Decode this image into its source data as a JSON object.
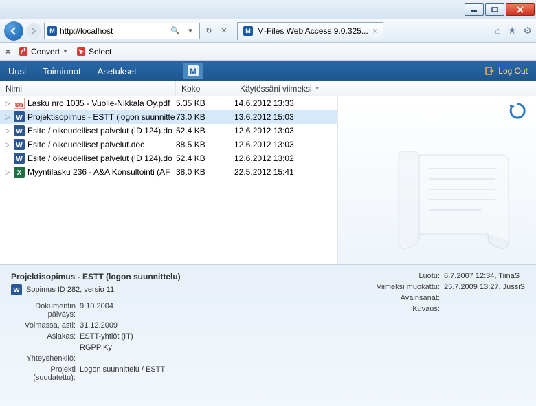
{
  "window": {
    "url": "http://localhost",
    "tab_title": "M-Files Web Access 9.0.325..."
  },
  "toolbar2": {
    "convert": "Convert",
    "select": "Select"
  },
  "menubar": {
    "new": "Uusi",
    "actions": "Toiminnot",
    "settings": "Asetukset",
    "logout": "Log Out"
  },
  "columns": {
    "name": "Nimi",
    "size": "Koko",
    "date": "Käytössäni viimeksi"
  },
  "files": [
    {
      "expandable": true,
      "icon": "pdf",
      "name": "Lasku nro 1035 - Vuolle-Nikkala Oy.pdf",
      "size": "5.35 KB",
      "date": "14.6.2012 13:33",
      "selected": false
    },
    {
      "expandable": true,
      "icon": "word",
      "name": "Projektisopimus - ESTT (logon suunnitte",
      "size": "73.0 KB",
      "date": "13.6.2012 15:03",
      "selected": true
    },
    {
      "expandable": true,
      "icon": "word",
      "name": "Esite / oikeudelliset palvelut (ID 124).do",
      "size": "52.4 KB",
      "date": "12.6.2012 13:03",
      "selected": false
    },
    {
      "expandable": true,
      "icon": "word",
      "name": "Esite / oikeudelliset palvelut.doc",
      "size": "88.5 KB",
      "date": "12.6.2012 13:03",
      "selected": false
    },
    {
      "expandable": false,
      "icon": "word",
      "name": "Esite / oikeudelliset palvelut (ID 124).do",
      "size": "52.4 KB",
      "date": "12.6.2012 13:02",
      "selected": false
    },
    {
      "expandable": true,
      "icon": "excel",
      "name": "Myyntilasku 236 - A&A Konsultointi (AF",
      "size": "38.0 KB",
      "date": "22.5.2012 15:41",
      "selected": false
    }
  ],
  "details": {
    "title": "Projektisopimus - ESTT (logon suunnittelu)",
    "subtitle": "Sopimus ID 282, versio 11",
    "left": [
      {
        "label": "Dokumentin päiväys:",
        "value": "9.10.2004"
      },
      {
        "label": "Voimassa, asti:",
        "value": "31.12.2009"
      },
      {
        "label": "Asiakas:",
        "value": "ESTT-yhtiöt (IT)"
      },
      {
        "label": "",
        "value": "RGPP Ky"
      },
      {
        "label": "Yhteyshenkilö:",
        "value": ""
      },
      {
        "label": "Projekti (suodatettu):",
        "value": "Logon suunnittelu / ESTT"
      }
    ],
    "right": [
      {
        "label": "Luotu:",
        "value": "6.7.2007 12:34, TiinaS"
      },
      {
        "label": "Viimeksi muokattu:",
        "value": "25.7.2009 13:27, JussiS"
      },
      {
        "label": "Avainsanat:",
        "value": ""
      },
      {
        "label": "Kuvaus:",
        "value": ""
      }
    ]
  }
}
